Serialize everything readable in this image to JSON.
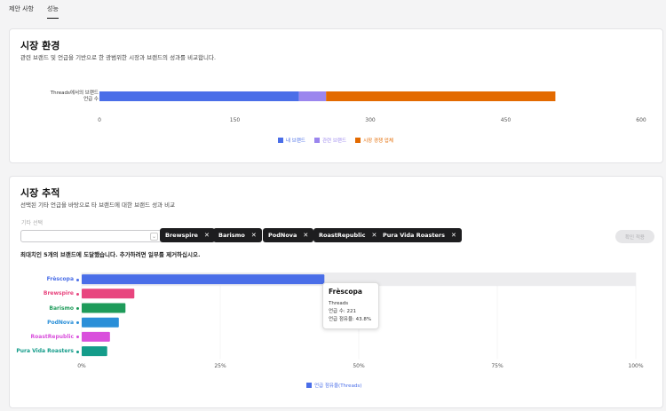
{
  "tabs": [
    {
      "label": "제안 사항",
      "active": false
    },
    {
      "label": "성능",
      "active": true
    }
  ],
  "market_env": {
    "title": "시장 환경",
    "subtitle": "관련 브랜드 및 언급을 기반으로 한 광범위한 시장과 브랜드의 성과를 비교합니다.",
    "bar_label_line1": "Threads에서의 브랜드",
    "bar_label_line2": "언급 수",
    "legend": [
      {
        "label": "내 브랜드",
        "color": "#4a6ee8"
      },
      {
        "label": "관련 브랜드",
        "color": "#9b86ee"
      },
      {
        "label": "시장 경쟁 업체",
        "color": "#e36a00"
      }
    ]
  },
  "market_track": {
    "title": "시장 추적",
    "subtitle": "선택된 기타 언급을 바탕으로 타 브랜드에 대한 브랜드 성과 비교",
    "select_label": "기타 선택",
    "select_value": "",
    "chips": [
      "Brewspire",
      "Barismo",
      "PodNova",
      "RoastRepublic",
      "Pura Vida Roasters"
    ],
    "confirm_button": "확인 적용",
    "notice": "최대치인 5개의 브랜드에 도달했습니다. 추가하려면 일부를 제거하십시오.",
    "legend": [
      {
        "label": "언급 점유율(Threads)",
        "color": "#4a6ee8"
      }
    ],
    "tooltip": {
      "title": "Frèscopa",
      "platform": "Threads",
      "mentions_line": "언급 수: 221",
      "share_line": "언급 점유율: 43.8%"
    }
  },
  "chart_data": [
    {
      "type": "bar",
      "orientation": "horizontal",
      "stacked": true,
      "categories": [
        "Threads에서의 브랜드 언급 수"
      ],
      "series": [
        {
          "name": "내 브랜드",
          "values": [
            221
          ],
          "color": "#4a6ee8"
        },
        {
          "name": "관련 브랜드",
          "values": [
            30
          ],
          "color": "#9b86ee"
        },
        {
          "name": "시장 경쟁 업체",
          "values": [
            254
          ],
          "color": "#e36a00"
        }
      ],
      "xlim": [
        0,
        600
      ],
      "xticks": [
        "0",
        "150",
        "300",
        "450",
        "600"
      ],
      "legend_position": "bottom"
    },
    {
      "type": "bar",
      "orientation": "horizontal",
      "categories": [
        "Frèscopa",
        "Brewspire",
        "Barismo",
        "PodNova",
        "RoastRepublic",
        "Pura Vida Roasters"
      ],
      "category_colors": [
        "#4a6ee8",
        "#e8457e",
        "#1e9b5a",
        "#2a8fd8",
        "#d94fdc",
        "#149c8a"
      ],
      "series": [
        {
          "name": "언급 점유율(Threads)",
          "values": [
            43.8,
            9.5,
            7.9,
            6.7,
            5.1,
            4.6
          ]
        }
      ],
      "xlim": [
        0,
        100
      ],
      "xticks": [
        "0%",
        "25%",
        "50%",
        "75%",
        "100%"
      ],
      "highlight_index": 0,
      "legend_position": "bottom"
    }
  ]
}
